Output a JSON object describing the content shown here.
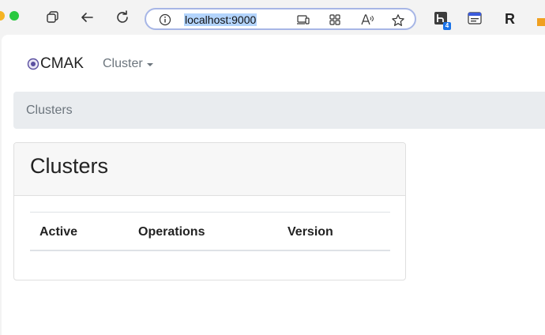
{
  "browser": {
    "url": "localhost:9000",
    "extension_badge": "4",
    "extension_letter": "R",
    "icons": [
      "tabs-icon",
      "back-arrow-icon",
      "reload-icon",
      "site-info-icon",
      "device-icon",
      "apps-icon",
      "read-aloud-icon",
      "favorite-star-icon",
      "extension-h-icon",
      "extension-window-icon",
      "extension-r-icon"
    ]
  },
  "navbar": {
    "brand": "CMAK",
    "cluster_menu": "Cluster"
  },
  "breadcrumb": {
    "current": "Clusters"
  },
  "clusters_card": {
    "title": "Clusters",
    "columns": [
      "Active",
      "Operations",
      "Version"
    ]
  },
  "colors": {
    "url_highlight": "#b3d4fc",
    "address_border": "#a7b6e6",
    "breadcrumb_bg": "#e9ecef",
    "card_header_bg": "#f7f7f7"
  }
}
